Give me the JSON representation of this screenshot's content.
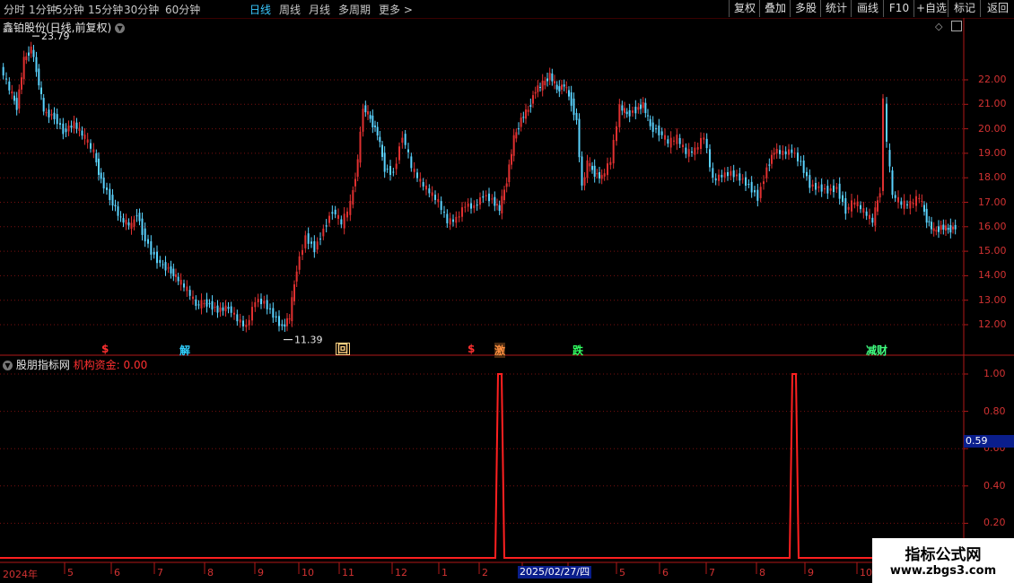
{
  "toolbar": {
    "periods": [
      "分时",
      "1分钟",
      "5分钟",
      "15分钟",
      "30分钟",
      "60分钟",
      "日线",
      "周线",
      "月线",
      "多周期",
      "更多 >"
    ],
    "active_index": 6,
    "right_buttons": [
      "复权",
      "叠加",
      "多股",
      "统计",
      "画线",
      "F10",
      "+自选",
      "标记",
      "返回"
    ]
  },
  "main_header": {
    "title": "鑫铂股份(日线,前复权)"
  },
  "main_chart": {
    "price_axis": [
      "22.00",
      "21.00",
      "20.00",
      "19.00",
      "18.00",
      "17.00",
      "16.00",
      "15.00",
      "14.00",
      "13.00",
      "12.00"
    ],
    "price_range": [
      11.0,
      24.3
    ],
    "high_label": "23.79",
    "low_label": "11.39",
    "up_color": "#e03030",
    "down_color": "#5ad3ff",
    "signals": [
      {
        "text": "$",
        "color": "#ff3030"
      },
      {
        "text": "解",
        "color": "#30d0ff"
      },
      {
        "text": "回",
        "color": "#ffd080"
      },
      {
        "text": "$",
        "color": "#ff3030"
      },
      {
        "text": "激",
        "color": "#ff9040"
      },
      {
        "text": "跌",
        "color": "#30ff60"
      },
      {
        "text": "减财",
        "color": "#40ff80"
      }
    ]
  },
  "indicator": {
    "name": "股朋指标网",
    "series_label": "机构资金: 0.00",
    "axis": [
      "1.00",
      "0.80",
      "0.60",
      "0.40",
      "0.20"
    ],
    "cursor_value": "0.59",
    "line_color": "#ff2020"
  },
  "date_axis": {
    "labels": [
      "2024年",
      "5",
      "6",
      "7",
      "8",
      "9",
      "10",
      "11",
      "12",
      "1",
      "2",
      "3",
      "4",
      "5",
      "6",
      "7",
      "8",
      "9",
      "10"
    ],
    "cursor_date": "2025/02/27/四"
  },
  "watermark": {
    "line1": "指标公式网",
    "line2": "www.zbgs3.com"
  }
}
